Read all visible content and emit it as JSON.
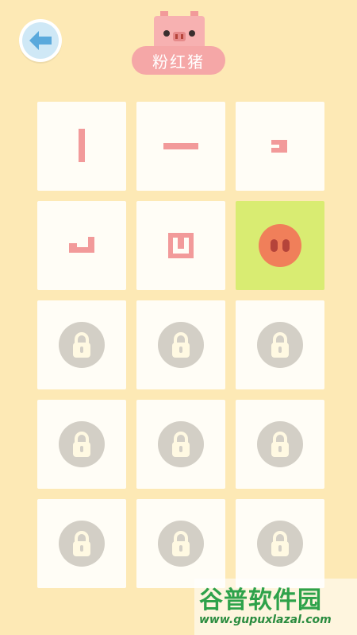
{
  "header": {
    "back_icon": "back-arrow-icon",
    "mascot_icon": "pig-head-icon",
    "title": "粉红猪"
  },
  "colors": {
    "background": "#fde9b5",
    "tile": "#fffdf6",
    "active_tile": "#d9ec72",
    "pink": "#f5a7a7",
    "lock": "#d3cfc6",
    "pig_nose": "#f07f5a"
  },
  "level_grid": {
    "columns": 3,
    "rows": 5,
    "tiles": [
      {
        "state": "completed",
        "icon": "vertical-bar-piece-icon"
      },
      {
        "state": "completed",
        "icon": "horizontal-bar-piece-icon"
      },
      {
        "state": "completed",
        "icon": "small-hook-piece-icon"
      },
      {
        "state": "completed",
        "icon": "l-shape-piece-icon"
      },
      {
        "state": "completed",
        "icon": "spiral-piece-icon"
      },
      {
        "state": "current",
        "icon": "pig-nose-icon"
      },
      {
        "state": "locked",
        "icon": "lock-icon"
      },
      {
        "state": "locked",
        "icon": "lock-icon"
      },
      {
        "state": "locked",
        "icon": "lock-icon"
      },
      {
        "state": "locked",
        "icon": "lock-icon"
      },
      {
        "state": "locked",
        "icon": "lock-icon"
      },
      {
        "state": "locked",
        "icon": "lock-icon"
      },
      {
        "state": "locked",
        "icon": "lock-icon"
      },
      {
        "state": "locked",
        "icon": "lock-icon"
      },
      {
        "state": "locked",
        "icon": "lock-icon"
      }
    ]
  },
  "watermark": {
    "title": "谷普软件园",
    "url": "www.gupuxlazal.com"
  }
}
